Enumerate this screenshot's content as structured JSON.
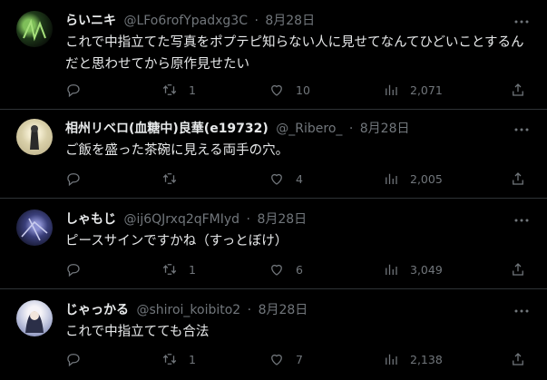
{
  "tweets": [
    {
      "name": "らいニキ",
      "handle": "@LFo6rofYpadxg3C",
      "date": "8月28日",
      "text": "これで中指立てた写真をポプテピ知らない人に見せてなんてひどいことするんだと思わせてから原作見せたい",
      "reply": "",
      "retweet": "1",
      "like": "10",
      "views": "2,071"
    },
    {
      "name": "相州リベロ(血糖中)良華(e19732)",
      "handle": "@_Ribero_",
      "date": "8月28日",
      "text": "ご飯を盛った茶碗に見える両手の穴。",
      "reply": "",
      "retweet": "",
      "like": "4",
      "views": "2,005"
    },
    {
      "name": "しゃもじ",
      "handle": "@ij6QJrxq2qFMIyd",
      "date": "8月28日",
      "text": "ピースサインですかね（すっとぼけ）",
      "reply": "",
      "retweet": "1",
      "like": "6",
      "views": "3,049"
    },
    {
      "name": "じゃっかる",
      "handle": "@shiroi_koibito2",
      "date": "8月28日",
      "text": "これで中指立てても合法",
      "reply": "",
      "retweet": "1",
      "like": "7",
      "views": "2,138"
    }
  ],
  "separator": "·",
  "icons": [
    "reply-icon",
    "retweet-icon",
    "like-icon",
    "views-icon",
    "share-icon",
    "more-icon"
  ],
  "colors": {
    "background": "#000000",
    "text": "#e7e9ea",
    "muted": "#71767b",
    "border": "#2f3336"
  }
}
